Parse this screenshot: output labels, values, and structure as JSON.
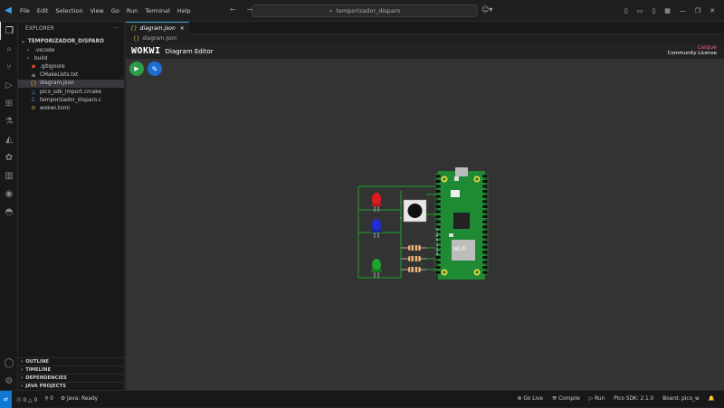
{
  "menu": [
    "File",
    "Edit",
    "Selection",
    "View",
    "Go",
    "Run",
    "Terminal",
    "Help"
  ],
  "search": {
    "text": "temporizador_disparo"
  },
  "sidebar": {
    "title": "EXPLORER",
    "more": "···",
    "project": "TEMPORIZADOR_DISPARO",
    "files": [
      {
        "name": ".vscode",
        "icon": ">",
        "depth": 1
      },
      {
        "name": "build",
        "icon": ">",
        "depth": 1
      },
      {
        "name": ".gitignore",
        "icon": "◆",
        "depth": 2
      },
      {
        "name": "CMakeLists.txt",
        "icon": "≡",
        "depth": 2
      },
      {
        "name": "diagram.json",
        "icon": "{}",
        "depth": 2
      },
      {
        "name": "pico_sdk_import.cmake",
        "icon": "△",
        "depth": 2
      },
      {
        "name": "temporizador_disparo.c",
        "icon": "C",
        "depth": 2
      },
      {
        "name": "wokwi.toml",
        "icon": "⚙",
        "depth": 2
      }
    ],
    "sections": [
      "OUTLINE",
      "TIMELINE",
      "DEPENDENCIES",
      "JAVA PROJECTS"
    ]
  },
  "editor": {
    "tab": "diagram.json",
    "tab_close": "×",
    "breadcrumb": "diagram.json",
    "wokwi_logo": "WOKWI",
    "wokwi_title": "Diagram Editor",
    "license_name": "caique",
    "license_type": "Community License"
  },
  "board": {
    "label_wifi": "Wi-Fi",
    "label_model": "Raspberry Pi Pico W"
  },
  "status": {
    "errors": "0",
    "warnings": "0",
    "ports": "0",
    "java": "Java: Ready",
    "golive": "Go Live",
    "compile": "Compile",
    "run": "Run",
    "sdk": "Pico SDK: 2.1.0",
    "board": "Board: pico_w"
  },
  "colors": {
    "accent": "#0e78d4",
    "run": "#2e9b47",
    "edit": "#1d6ed3",
    "board": "#1e8a34",
    "led_red": "#e01b1b",
    "led_blue": "#1f2fd6",
    "led_green": "#1fa32a"
  }
}
